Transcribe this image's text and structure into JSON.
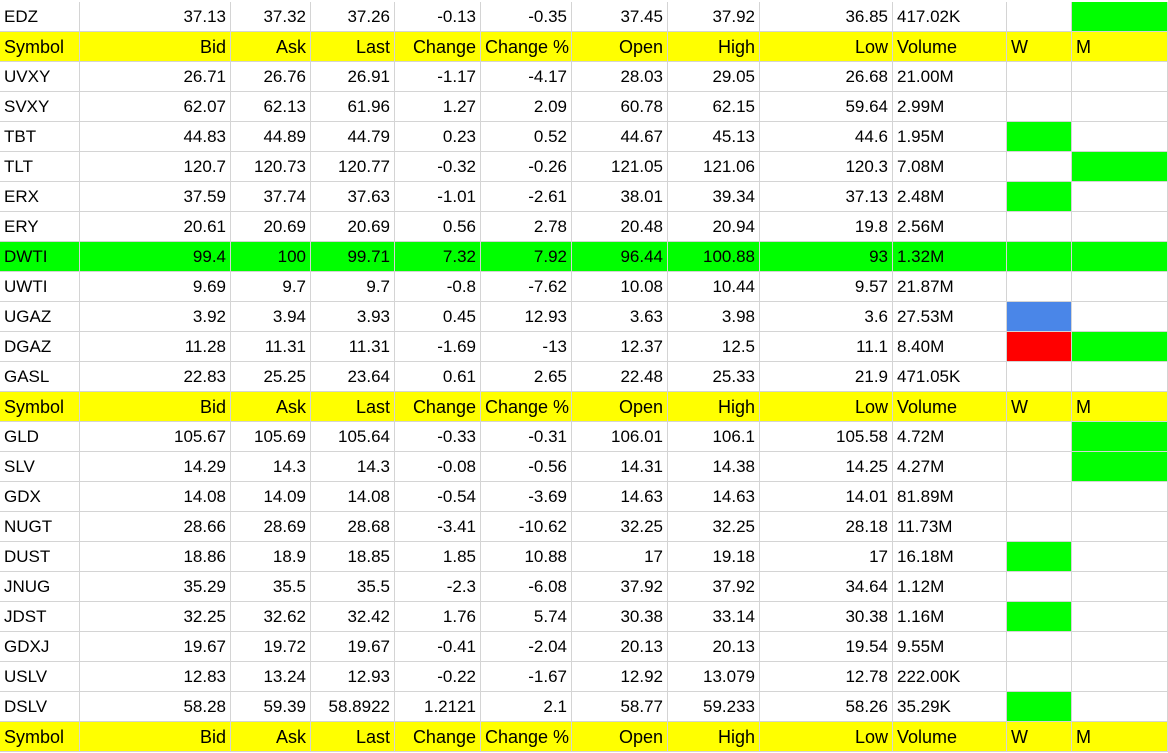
{
  "columns": [
    "Symbol",
    "Bid",
    "Ask",
    "Last",
    "Change",
    "Change %",
    "Open",
    "High",
    "Low",
    "Volume",
    "W",
    "M"
  ],
  "colors": {
    "header": "#ffff00",
    "highlight": "#00ff00",
    "green": "#00ff00",
    "blue": "#4a86e8",
    "red": "#ff0000"
  },
  "rows": [
    {
      "type": "data",
      "cells": [
        "EDZ",
        "37.13",
        "37.32",
        "37.26",
        "-0.13",
        "-0.35",
        "37.45",
        "37.92",
        "36.85",
        "417.02K"
      ],
      "w": "",
      "m": "green"
    },
    {
      "type": "header",
      "cells": [
        "Symbol",
        "Bid",
        "Ask",
        "Last",
        "Change",
        "Change %",
        "Open",
        "High",
        "Low",
        "Volume",
        "W",
        "M"
      ]
    },
    {
      "type": "data",
      "cells": [
        "UVXY",
        "26.71",
        "26.76",
        "26.91",
        "-1.17",
        "-4.17",
        "28.03",
        "29.05",
        "26.68",
        "21.00M"
      ],
      "w": "",
      "m": ""
    },
    {
      "type": "data",
      "cells": [
        "SVXY",
        "62.07",
        "62.13",
        "61.96",
        "1.27",
        "2.09",
        "60.78",
        "62.15",
        "59.64",
        "2.99M"
      ],
      "w": "",
      "m": ""
    },
    {
      "type": "data",
      "cells": [
        "TBT",
        "44.83",
        "44.89",
        "44.79",
        "0.23",
        "0.52",
        "44.67",
        "45.13",
        "44.6",
        "1.95M"
      ],
      "w": "green",
      "m": ""
    },
    {
      "type": "data",
      "cells": [
        "TLT",
        "120.7",
        "120.73",
        "120.77",
        "-0.32",
        "-0.26",
        "121.05",
        "121.06",
        "120.3",
        "7.08M"
      ],
      "w": "",
      "m": "green"
    },
    {
      "type": "data",
      "cells": [
        "ERX",
        "37.59",
        "37.74",
        "37.63",
        "-1.01",
        "-2.61",
        "38.01",
        "39.34",
        "37.13",
        "2.48M"
      ],
      "w": "green",
      "m": ""
    },
    {
      "type": "data",
      "cells": [
        "ERY",
        "20.61",
        "20.69",
        "20.69",
        "0.56",
        "2.78",
        "20.48",
        "20.94",
        "19.8",
        "2.56M"
      ],
      "w": "",
      "m": ""
    },
    {
      "type": "highlight",
      "cells": [
        "DWTI",
        "99.4",
        "100",
        "99.71",
        "7.32",
        "7.92",
        "96.44",
        "100.88",
        "93",
        "1.32M"
      ],
      "w": "",
      "m": ""
    },
    {
      "type": "data",
      "cells": [
        "UWTI",
        "9.69",
        "9.7",
        "9.7",
        "-0.8",
        "-7.62",
        "10.08",
        "10.44",
        "9.57",
        "21.87M"
      ],
      "w": "",
      "m": ""
    },
    {
      "type": "data",
      "cells": [
        "UGAZ",
        "3.92",
        "3.94",
        "3.93",
        "0.45",
        "12.93",
        "3.63",
        "3.98",
        "3.6",
        "27.53M"
      ],
      "w": "blue",
      "m": ""
    },
    {
      "type": "data",
      "cells": [
        "DGAZ",
        "11.28",
        "11.31",
        "11.31",
        "-1.69",
        "-13",
        "12.37",
        "12.5",
        "11.1",
        "8.40M"
      ],
      "w": "red",
      "m": "green"
    },
    {
      "type": "data",
      "cells": [
        "GASL",
        "22.83",
        "25.25",
        "23.64",
        "0.61",
        "2.65",
        "22.48",
        "25.33",
        "21.9",
        "471.05K"
      ],
      "w": "",
      "m": ""
    },
    {
      "type": "header",
      "cells": [
        "Symbol",
        "Bid",
        "Ask",
        "Last",
        "Change",
        "Change %",
        "Open",
        "High",
        "Low",
        "Volume",
        "W",
        "M"
      ]
    },
    {
      "type": "data",
      "cells": [
        "GLD",
        "105.67",
        "105.69",
        "105.64",
        "-0.33",
        "-0.31",
        "106.01",
        "106.1",
        "105.58",
        "4.72M"
      ],
      "w": "",
      "m": "green"
    },
    {
      "type": "data",
      "cells": [
        "SLV",
        "14.29",
        "14.3",
        "14.3",
        "-0.08",
        "-0.56",
        "14.31",
        "14.38",
        "14.25",
        "4.27M"
      ],
      "w": "",
      "m": "green"
    },
    {
      "type": "data",
      "cells": [
        "GDX",
        "14.08",
        "14.09",
        "14.08",
        "-0.54",
        "-3.69",
        "14.63",
        "14.63",
        "14.01",
        "81.89M"
      ],
      "w": "",
      "m": ""
    },
    {
      "type": "data",
      "cells": [
        "NUGT",
        "28.66",
        "28.69",
        "28.68",
        "-3.41",
        "-10.62",
        "32.25",
        "32.25",
        "28.18",
        "11.73M"
      ],
      "w": "",
      "m": ""
    },
    {
      "type": "data",
      "cells": [
        "DUST",
        "18.86",
        "18.9",
        "18.85",
        "1.85",
        "10.88",
        "17",
        "19.18",
        "17",
        "16.18M"
      ],
      "w": "green",
      "m": ""
    },
    {
      "type": "data",
      "cells": [
        "JNUG",
        "35.29",
        "35.5",
        "35.5",
        "-2.3",
        "-6.08",
        "37.92",
        "37.92",
        "34.64",
        "1.12M"
      ],
      "w": "",
      "m": ""
    },
    {
      "type": "data",
      "cells": [
        "JDST",
        "32.25",
        "32.62",
        "32.42",
        "1.76",
        "5.74",
        "30.38",
        "33.14",
        "30.38",
        "1.16M"
      ],
      "w": "green",
      "m": ""
    },
    {
      "type": "data",
      "cells": [
        "GDXJ",
        "19.67",
        "19.72",
        "19.67",
        "-0.41",
        "-2.04",
        "20.13",
        "20.13",
        "19.54",
        "9.55M"
      ],
      "w": "",
      "m": ""
    },
    {
      "type": "data",
      "cells": [
        "USLV",
        "12.83",
        "13.24",
        "12.93",
        "-0.22",
        "-1.67",
        "12.92",
        "13.079",
        "12.78",
        "222.00K"
      ],
      "w": "",
      "m": ""
    },
    {
      "type": "data",
      "cells": [
        "DSLV",
        "58.28",
        "59.39",
        "58.8922",
        "1.2121",
        "2.1",
        "58.77",
        "59.233",
        "58.26",
        "35.29K"
      ],
      "w": "green",
      "m": ""
    },
    {
      "type": "header",
      "cells": [
        "Symbol",
        "Bid",
        "Ask",
        "Last",
        "Change",
        "Change %",
        "Open",
        "High",
        "Low",
        "Volume",
        "W",
        "M"
      ]
    }
  ]
}
